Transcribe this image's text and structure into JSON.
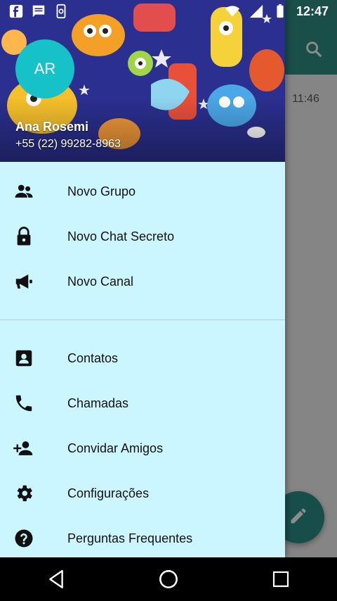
{
  "status_bar": {
    "time": "12:47"
  },
  "drawer": {
    "header": {
      "avatar_initials": "AR",
      "user_name": "Ana Rosemi",
      "phone": "+55 (22) 99282-8963"
    },
    "menu_top": [
      {
        "label": "Novo Grupo",
        "icon": "group-icon"
      },
      {
        "label": "Novo Chat Secreto",
        "icon": "lock-icon"
      },
      {
        "label": "Novo Canal",
        "icon": "megaphone-icon"
      }
    ],
    "menu_bottom": [
      {
        "label": "Contatos",
        "icon": "contact-icon"
      },
      {
        "label": "Chamadas",
        "icon": "phone-icon"
      },
      {
        "label": "Convidar Amigos",
        "icon": "add-person-icon"
      },
      {
        "label": "Configurações",
        "icon": "gear-icon"
      },
      {
        "label": "Perguntas Frequentes",
        "icon": "help-icon"
      }
    ]
  },
  "background_app": {
    "chat_time": "11:46"
  },
  "colors": {
    "drawer_bg": "#ccf6ff",
    "avatar_bg": "#16c2c8",
    "accent": "#2f8f86"
  }
}
